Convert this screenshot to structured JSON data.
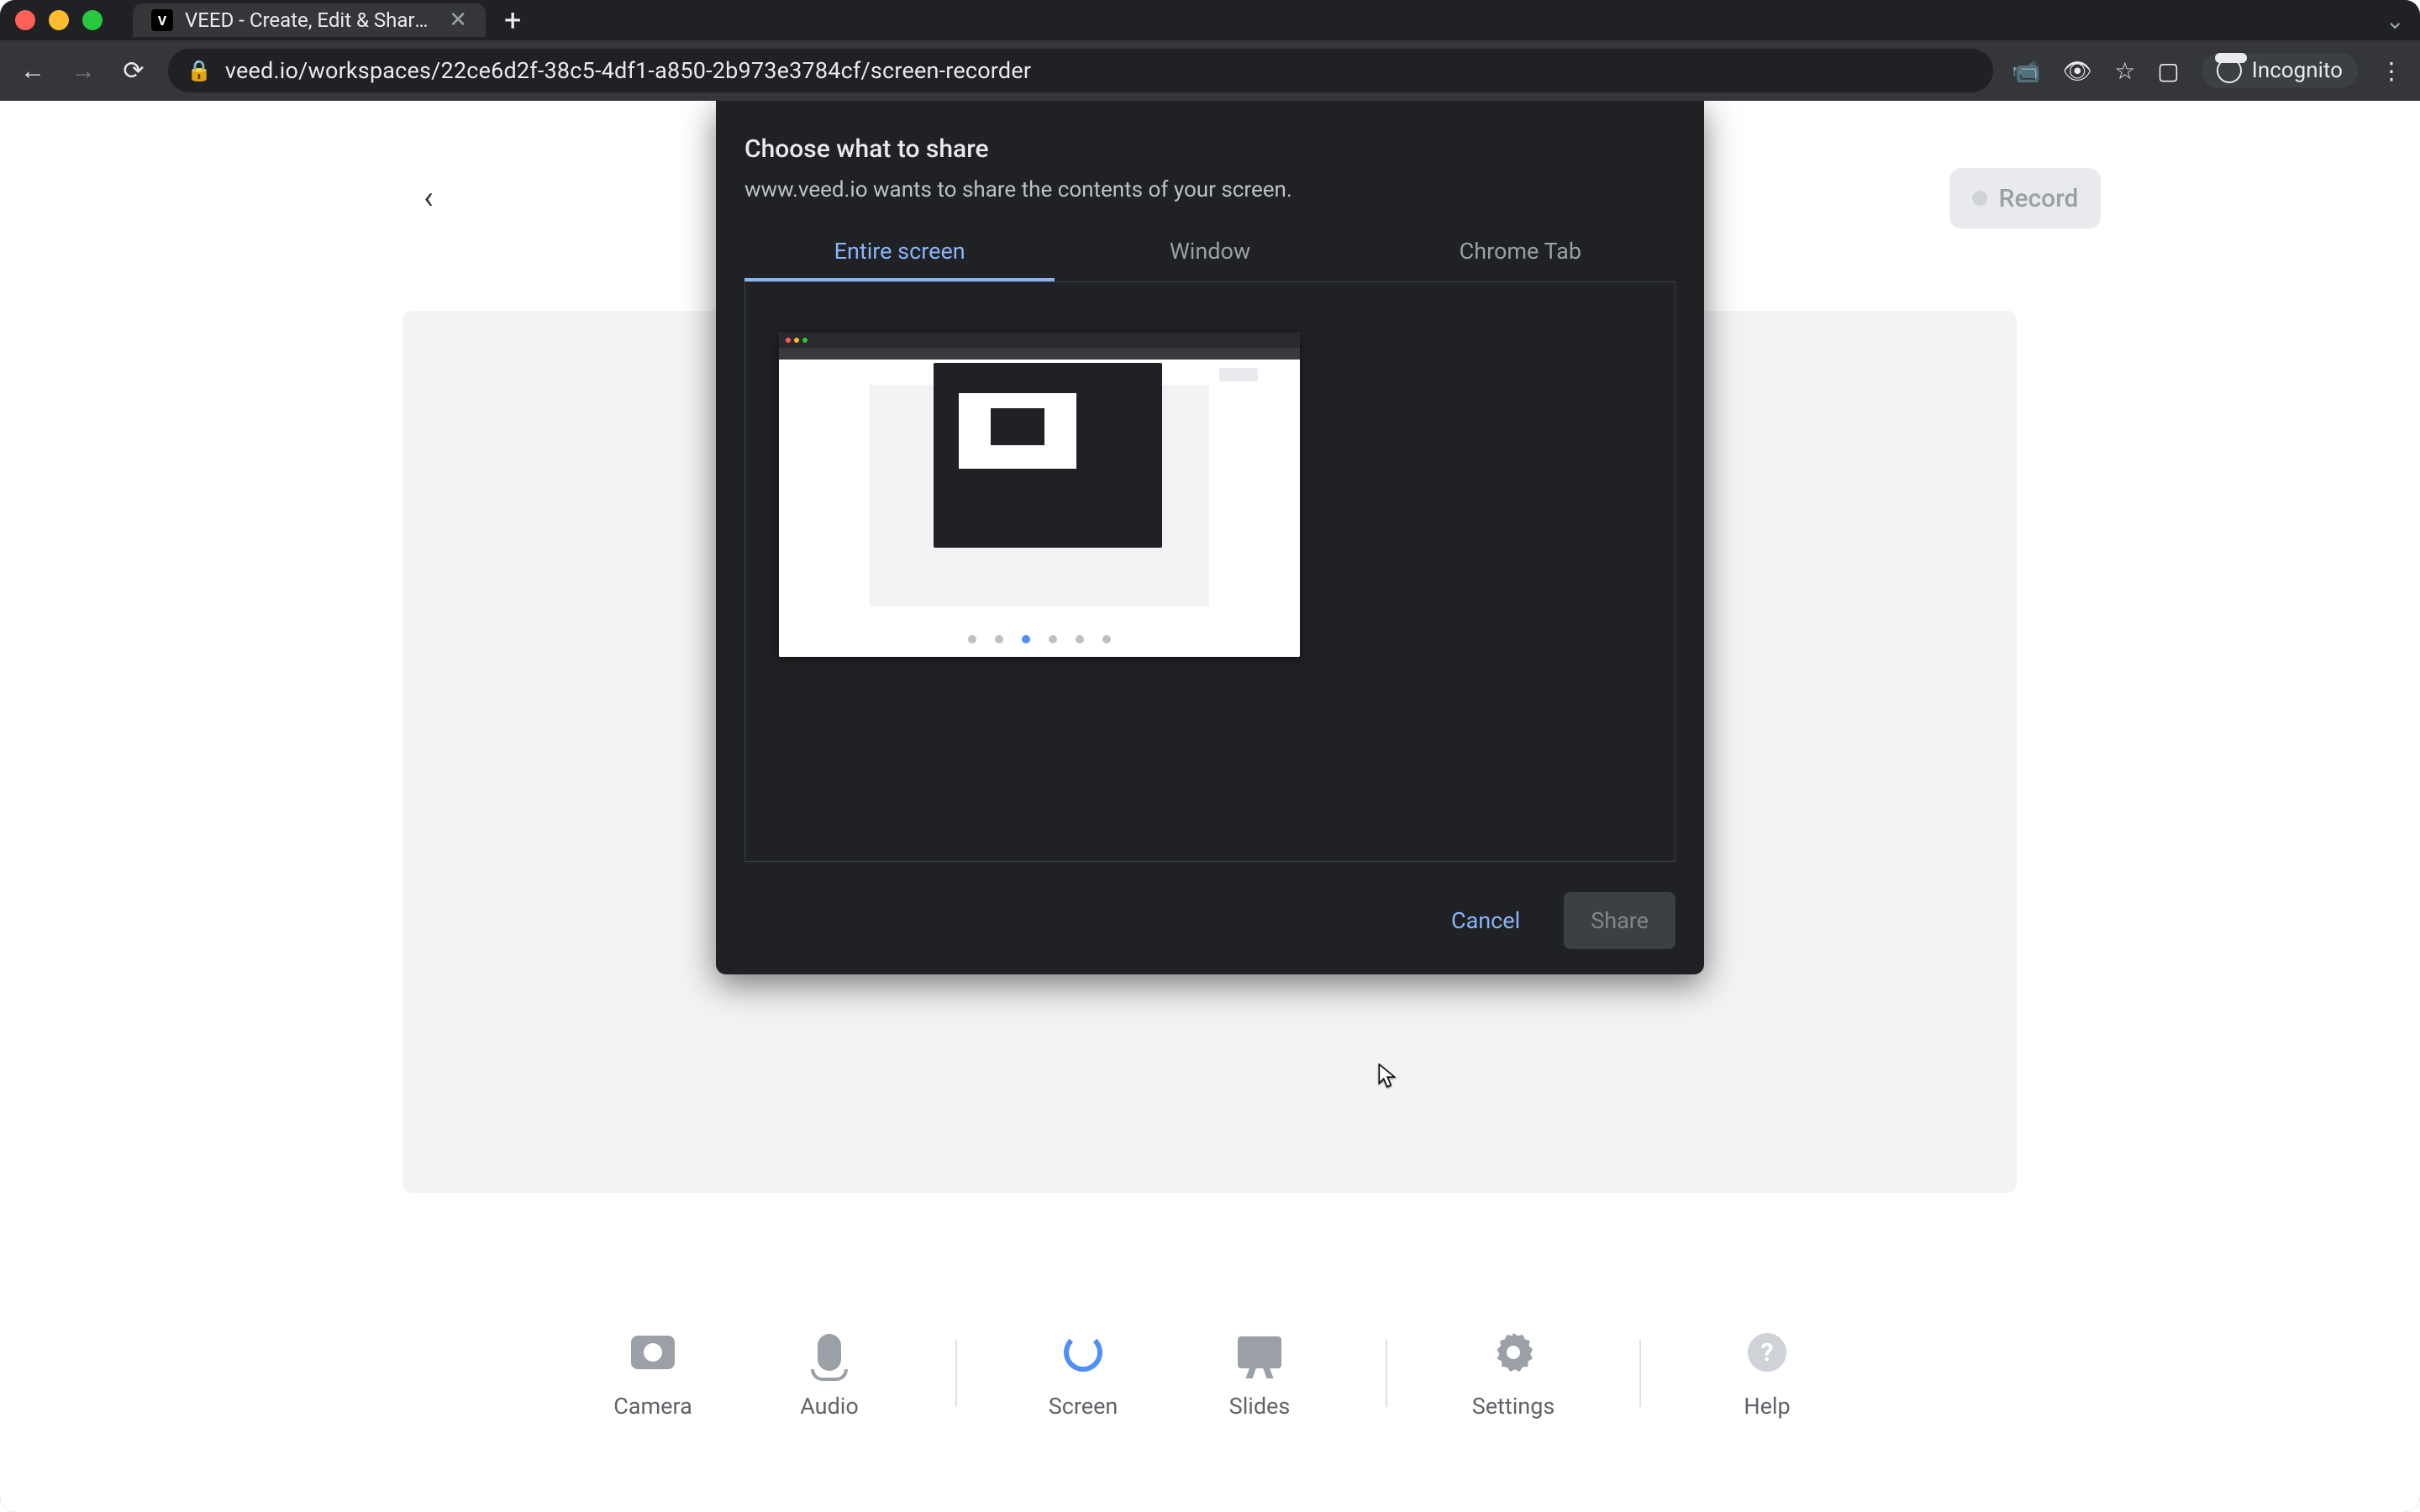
{
  "browser": {
    "tab_title": "VEED - Create, Edit & Share Vi",
    "tab_favicon": "V",
    "url": "veed.io/workspaces/22ce6d2f-38c5-4df1-a850-2b973e3784cf/screen-recorder",
    "incognito_label": "Incognito"
  },
  "header": {
    "record_label": "Record"
  },
  "toolbar": {
    "camera": "Camera",
    "audio": "Audio",
    "screen": "Screen",
    "slides": "Slides",
    "settings": "Settings",
    "help": "Help"
  },
  "modal": {
    "title": "Choose what to share",
    "subtitle": "www.veed.io wants to share the contents of your screen.",
    "tabs": {
      "entire_screen": "Entire screen",
      "window": "Window",
      "chrome_tab": "Chrome Tab"
    },
    "cancel": "Cancel",
    "share": "Share"
  }
}
